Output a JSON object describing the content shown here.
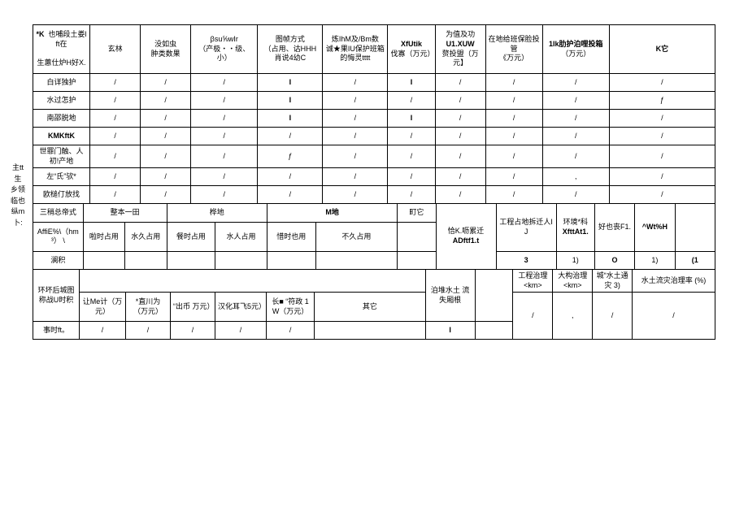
{
  "sideLabel": "主tt生 乡领 临也 纵m 卜:",
  "t1": {
    "h0a": "*K",
    "h0b": "也哺段土娄lft在",
    "h0c": "生蕙仕炉H好X.",
    "h1": "玄林",
    "h2a": "没如虫",
    "h2b": "肿类数果",
    "h3a": "βsu⅝wIr",
    "h3b": "（产极・・级、小）",
    "h4a": "图帧方式",
    "h4b": "（占用、诂HHH",
    "h4c": "肖说4幼C",
    "h5a": "炼IhM及/Bm数",
    "h5b": "诚★果IU保护班箱",
    "h5c": "的悔灵tttt",
    "h6a": "XfUtik",
    "h6b": "伐寡（万元）",
    "h7a": "为值及功",
    "h7b": "U1.XUW",
    "h7c": "赘投盟（万元】",
    "h8a": "在地给班保脸投管",
    "h8b": "《万元）",
    "h9a": "1Ik肋护泊哩投箱",
    "h9b": "（万元）",
    "h10": "K它",
    "r1": "白详独护",
    "r2": "水过怎护",
    "r3": "南邵脱地",
    "r4": "KMKftK",
    "r5": "世罪门触、人初!产地",
    "r6": "左“氏”欤*",
    "r7": "欧槌仃放找"
  },
  "t2": {
    "h0a": "三稍总帝式",
    "h1": "整本一田",
    "h2": "桦地",
    "h3": "M地",
    "h4": "町它",
    "h5a": "恰K.呖累迁",
    "h5b": "ADftf1.t",
    "h6": "工程占地拆迁人IJ",
    "h7a": "环境*科",
    "h7b": "XfttAt1.",
    "h8": "好也丧F1.",
    "h9": "^Wt%H",
    "r2l": "AffiE%\\（hm³） \\",
    "r2c1": "啦时占用",
    "r2c2": "水久占用",
    "r2c3": "餐时占用",
    "r2c4": "水人占用",
    "r2c5": "惜时也用",
    "r2c6": "不久占用",
    "r2c8": "3",
    "r2c9": "1)",
    "r2c10": "O",
    "r2c11": "1)",
    "r2c12": "(1",
    "r3": "澜积"
  },
  "t3": {
    "h0": "环坏后城图称战U时积",
    "h1": "工程治理 <km>",
    "h2": "大构治理 <km>",
    "h3": "城“水土通灾 3)",
    "h4": "水土流灾治理率 (%)",
    "r1l": "事时ft。",
    "r1c1": "让Me计（万元）",
    "r1c2": "*直川为（万元）",
    "r1c3": "“出币 万元）",
    "r1c4": "汉化耳飞5元）",
    "r1c5": "长■ “符政 1W（万元）",
    "r1c6": "其它",
    "r1c7": "泊堆水土 流失厢根",
    "slash": "/"
  },
  "sl": "/",
  "slb": "I",
  "slf": "ƒ"
}
